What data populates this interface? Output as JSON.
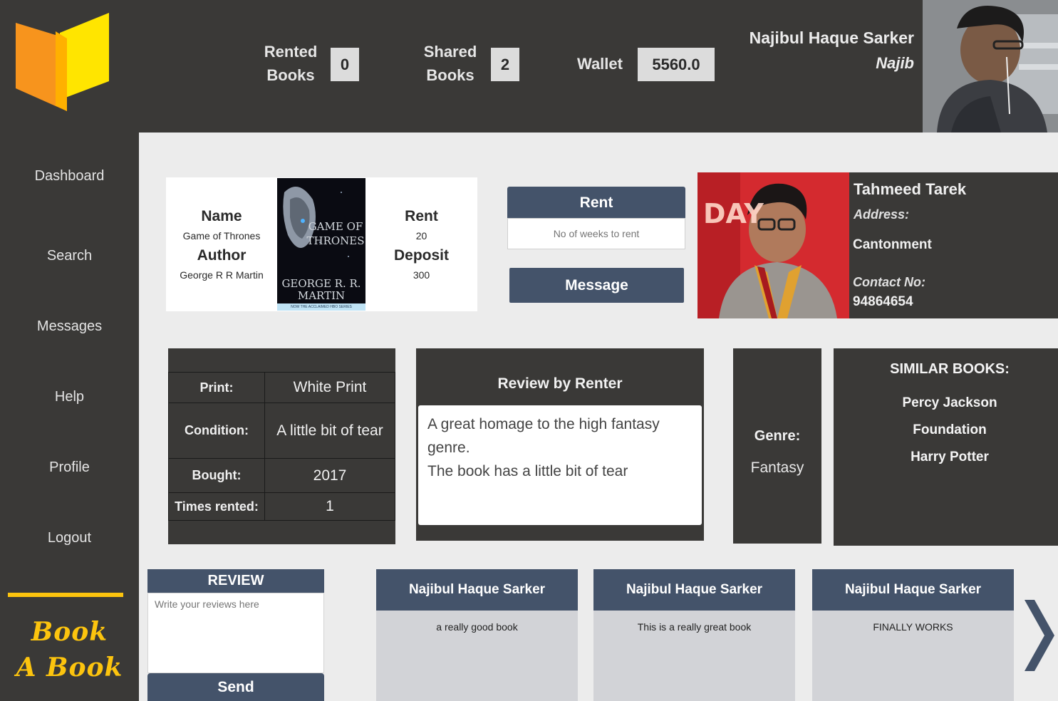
{
  "header": {
    "rented_label": "Rented Books",
    "rented_label_1": "Rented",
    "rented_label_2": "Books",
    "rented_value": "0",
    "shared_label_1": "Shared",
    "shared_label_2": "Books",
    "shared_value": "2",
    "wallet_label": "Wallet",
    "wallet_value": "5560.0",
    "user_name": "Najibul Haque Sarker",
    "user_handle": "Najib"
  },
  "sidebar": {
    "items": [
      {
        "label": "Dashboard"
      },
      {
        "label": "Search"
      },
      {
        "label": "Messages"
      },
      {
        "label": "Help"
      },
      {
        "label": "Profile"
      },
      {
        "label": "Logout"
      }
    ],
    "brand_line1": "Book",
    "brand_line2": "A Book",
    "brand_color": "#fcc40e"
  },
  "book": {
    "name_label": "Name",
    "name": "Game of Thrones",
    "author_label": "Author",
    "author": "George R R Martin",
    "rent_label": "Rent",
    "rent": "20",
    "deposit_label": "Deposit",
    "deposit": "300",
    "cover_title_1": "GAME OF",
    "cover_title_2": "THRONES",
    "cover_author_1": "GEORGE R. R.",
    "cover_author_2": "MARTIN",
    "cover_strip": "NOW THE ACCLAIMED HBO SERIES"
  },
  "actions": {
    "rent_button": "Rent",
    "weeks_placeholder": "No of weeks to rent",
    "message_button": "Message"
  },
  "owner": {
    "name": "Tahmeed Tarek",
    "address_label": "Address:",
    "address": "Cantonment",
    "contact_label": "Contact No:",
    "contact": "94864654",
    "photo_text": "DAY"
  },
  "details": [
    {
      "key": "Print:",
      "value": "White Print"
    },
    {
      "key": "Condition:",
      "value": "A little bit of tear"
    },
    {
      "key": "Bought:",
      "value": "2017"
    },
    {
      "key": "Times rented:",
      "value": "1"
    }
  ],
  "renter_review": {
    "title": "Review by Renter",
    "line1": "A great homage to the high fantasy",
    "line2": "genre.",
    "line3": "The book has a little bit of tear"
  },
  "genre": {
    "label": "Genre:",
    "value": "Fantasy"
  },
  "similar": {
    "title": "SIMILAR BOOKS:",
    "items": [
      "Percy Jackson",
      "Foundation",
      "Harry Potter"
    ]
  },
  "review_form": {
    "title": "REVIEW",
    "placeholder": "Write your reviews here",
    "send_button": "Send"
  },
  "reviews": [
    {
      "author": "Najibul Haque Sarker",
      "text": "a really good book"
    },
    {
      "author": "Najibul Haque Sarker",
      "text": "This is a really great book"
    },
    {
      "author": "Najibul Haque Sarker",
      "text": "FINALLY WORKS"
    }
  ],
  "icons": {
    "logo": "open-book-logo-icon",
    "next": "chevron-right-icon"
  },
  "colors": {
    "dark_panel": "#3a3937",
    "accent_button": "#44536a",
    "background": "#ececec",
    "logo_orange": "#f7941d",
    "logo_yellow": "#ffe500"
  }
}
